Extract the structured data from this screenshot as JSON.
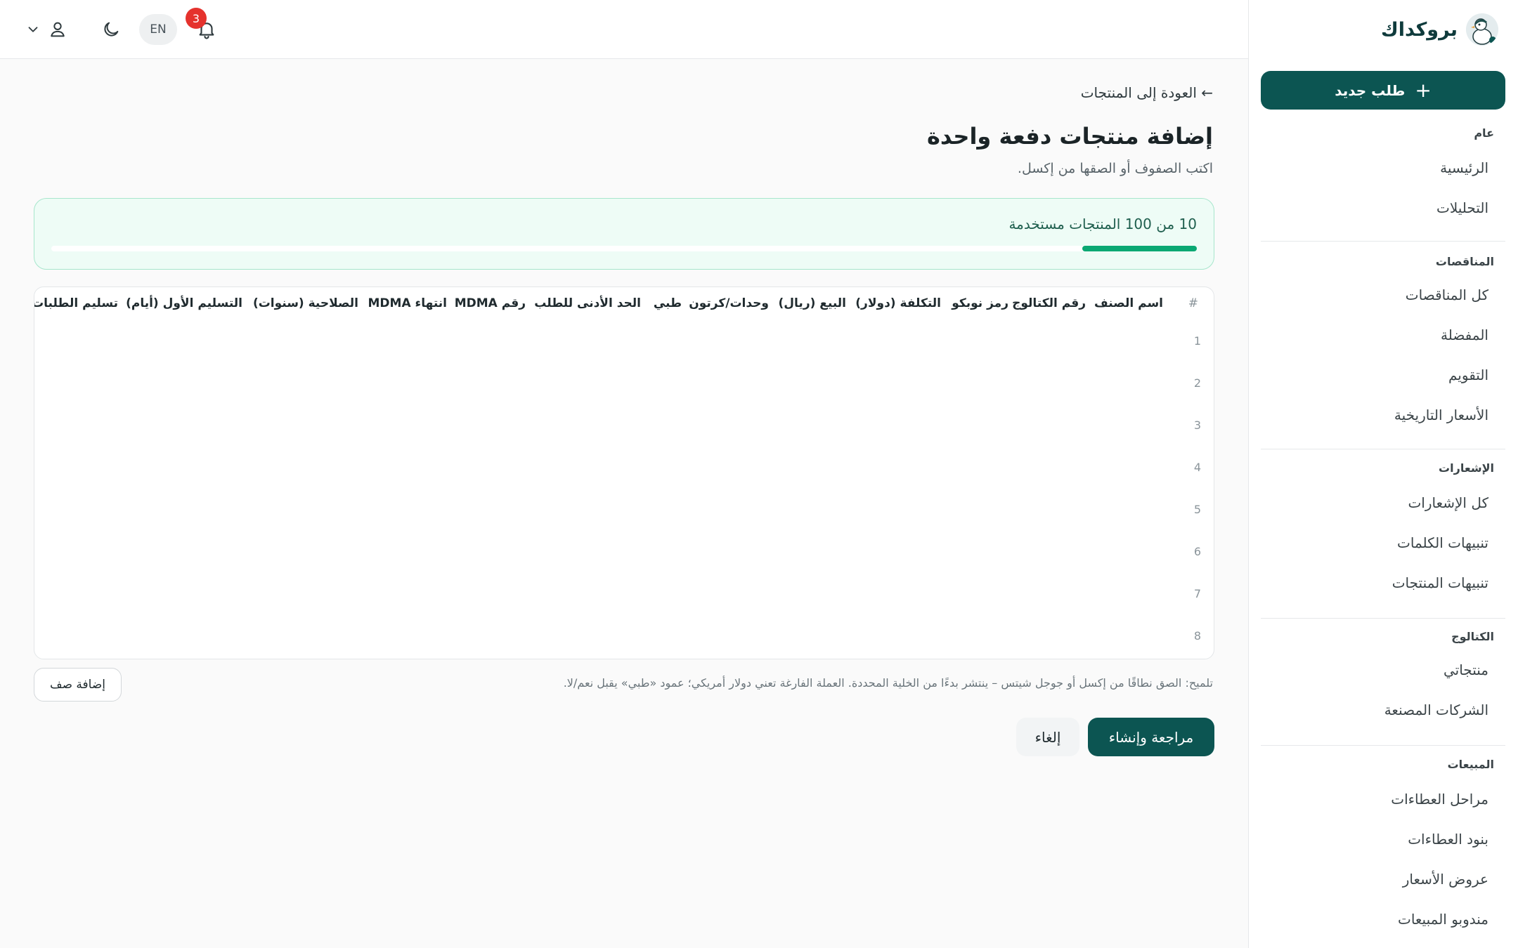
{
  "brand": {
    "name": "بروكداك"
  },
  "sidebar": {
    "new_order_label": "طلب جديد",
    "sections": [
      {
        "title": "عام",
        "items": [
          "الرئيسية",
          "التحليلات"
        ]
      },
      {
        "title": "المناقصات",
        "items": [
          "كل المناقصات",
          "المفضلة",
          "التقويم",
          "الأسعار التاريخية"
        ]
      },
      {
        "title": "الإشعارات",
        "items": [
          "كل الإشعارات",
          "تنبيهات الكلمات",
          "تنبيهات المنتجات"
        ]
      },
      {
        "title": "الكتالوج",
        "items": [
          "منتجاتي",
          "الشركات المصنعة"
        ]
      },
      {
        "title": "المبيعات",
        "items": [
          "مراحل العطاءات",
          "بنود العطاءات",
          "عروض الأسعار",
          "مندوبو المبيعات"
        ]
      }
    ]
  },
  "topbar": {
    "notifications_count": "3",
    "language_label": "EN"
  },
  "main": {
    "back_link": "← العودة إلى المنتجات",
    "title": "إضافة منتجات دفعة واحدة",
    "subtitle": "اكتب الصفوف أو الصقها من إكسل.",
    "usage": {
      "text": "10 من 100 المنتجات مستخدمة",
      "used": 10,
      "limit": 100
    },
    "grid": {
      "columns": [
        "#",
        "اسم الصنف",
        "رقم الكتالوج",
        "رمز نوبكو",
        "التكلفة (دولار)",
        "البيع (ريال)",
        "وحدات/كرتون",
        "طبي",
        "الحد الأدنى للطلب",
        "رقم MDMA",
        "انتهاء MDMA",
        "الصلاحية (سنوات)",
        "التسليم الأول (أيام)",
        "تسليم الطلبات (أيام)"
      ],
      "rows": [
        "1",
        "2",
        "3",
        "4",
        "5",
        "6",
        "7",
        "8"
      ]
    },
    "hint": "تلميح: الصق نطاقًا من إكسل أو جوجل شيتس – ينتشر بدءًا من الخلية المحددة. العملة الفارغة تعني دولار أمريكي؛ عمود «طبي» يقبل نعم/لا.",
    "add_row_label": "إضافة صف",
    "review_label": "مراجعة وإنشاء",
    "cancel_label": "إلغاء"
  },
  "colors": {
    "primary": "#0c5552",
    "progress": "#0aa873",
    "badge": "#e5322d"
  }
}
